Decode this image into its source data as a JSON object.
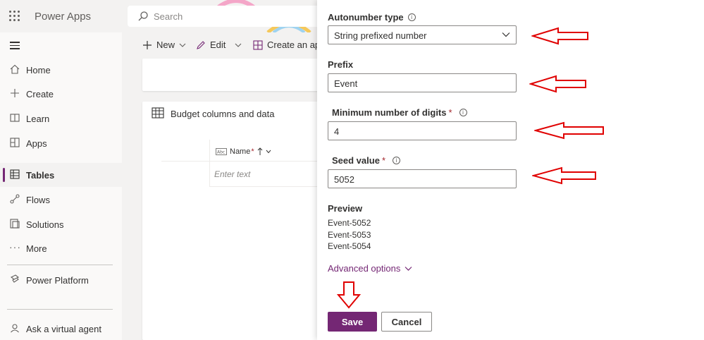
{
  "header": {
    "app_title": "Power Apps",
    "search_placeholder": "Search"
  },
  "sidebar": {
    "items": [
      {
        "label": "Home",
        "icon": "home-icon"
      },
      {
        "label": "Create",
        "icon": "plus-icon"
      },
      {
        "label": "Learn",
        "icon": "book-icon"
      },
      {
        "label": "Apps",
        "icon": "apps-icon"
      },
      {
        "label": "Tables",
        "icon": "table-icon",
        "active": true
      },
      {
        "label": "Flows",
        "icon": "flow-icon"
      },
      {
        "label": "Solutions",
        "icon": "solutions-icon"
      },
      {
        "label": "More",
        "icon": "more-icon"
      },
      {
        "label": "Power Platform",
        "icon": "power-platform-icon"
      },
      {
        "label": "Ask a virtual agent",
        "icon": "virtual-agent-icon"
      }
    ]
  },
  "commandbar": {
    "new_label": "New",
    "edit_label": "Edit",
    "create_app_label": "Create an app"
  },
  "budget": {
    "title": "Budget columns and data",
    "column_name": "Name",
    "required_mark": "*",
    "cell_placeholder": "Enter text"
  },
  "panel": {
    "autonumber_type_label": "Autonumber type",
    "autonumber_type_value": "String prefixed number",
    "prefix_label": "Prefix",
    "prefix_value": "Event",
    "min_digits_label": "Minimum number of digits",
    "min_digits_value": "4",
    "seed_label": "Seed value",
    "seed_value": "5052",
    "required_mark": "*",
    "preview_label": "Preview",
    "preview": [
      "Event-5052",
      "Event-5053",
      "Event-5054"
    ],
    "advanced_label": "Advanced options",
    "save_label": "Save",
    "cancel_label": "Cancel"
  },
  "colors": {
    "accent": "#742774",
    "annotation_arrow": "#e00000"
  }
}
